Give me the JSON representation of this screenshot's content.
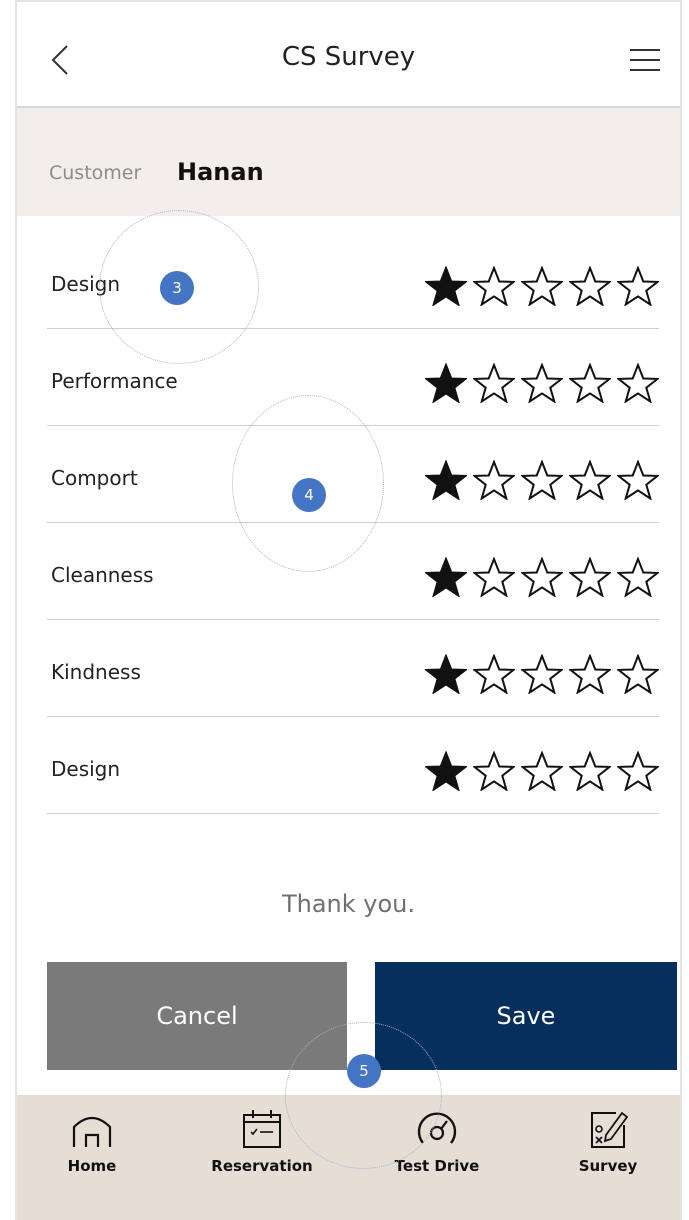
{
  "header": {
    "title": "CS Survey",
    "back_icon": "chevron-left-icon",
    "menu_icon": "hamburger-menu-icon"
  },
  "customer": {
    "label": "Customer",
    "name": "Hanan"
  },
  "survey": {
    "max_rating": 5,
    "items": [
      {
        "label": "Design",
        "rating": 1
      },
      {
        "label": "Performance",
        "rating": 1
      },
      {
        "label": "Comport",
        "rating": 1
      },
      {
        "label": "Cleanness",
        "rating": 1
      },
      {
        "label": "Kindness",
        "rating": 1
      },
      {
        "label": "Design",
        "rating": 1
      }
    ]
  },
  "message": "Thank you.",
  "actions": {
    "cancel_label": "Cancel",
    "save_label": "Save"
  },
  "tabbar": {
    "items": [
      {
        "label": "Home",
        "icon": "home-icon"
      },
      {
        "label": "Reservation",
        "icon": "calendar-icon"
      },
      {
        "label": "Test Drive",
        "icon": "speedometer-icon"
      },
      {
        "label": "Survey",
        "icon": "survey-edit-icon"
      }
    ]
  },
  "annotations": [
    "3",
    "4",
    "5"
  ],
  "colors": {
    "save_bg": "#062f5d",
    "cancel_bg": "#7a7a7a",
    "customer_bg": "#f3eeeb",
    "tabbar_bg": "#e6ded5",
    "badge": "#4474c4"
  }
}
